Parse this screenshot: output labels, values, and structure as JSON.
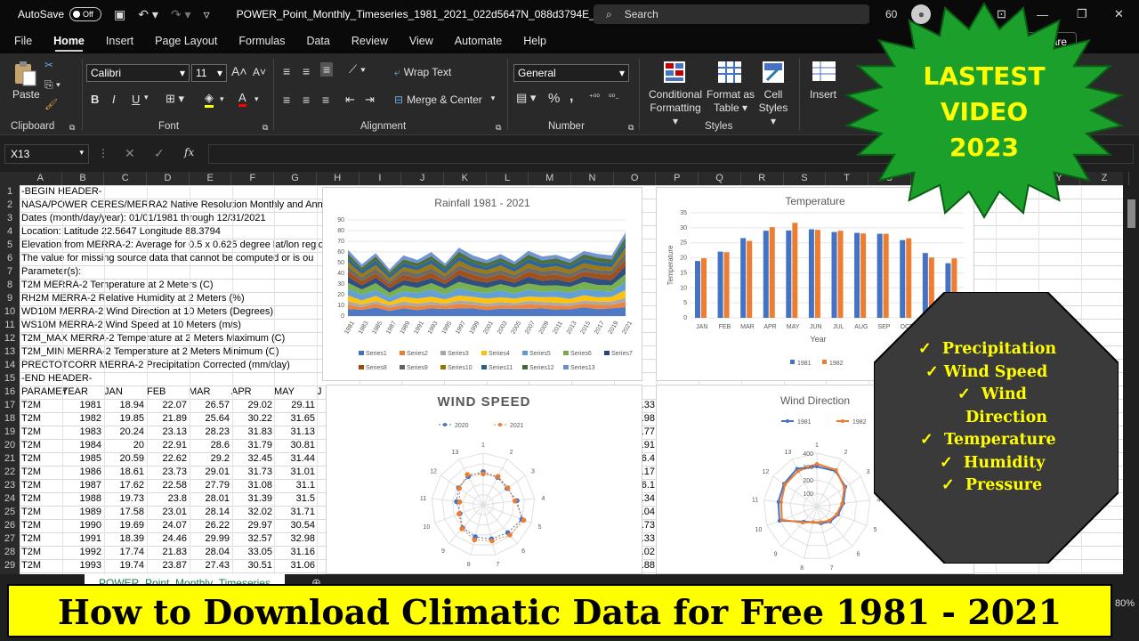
{
  "titlebar": {
    "autosave": "AutoSave",
    "toggle": "Off",
    "filename": "POWER_Point_Monthly_Timeseries_1981_2021_022d5647N_088d3794E_LST",
    "search": "Search",
    "zoom_partial": "60"
  },
  "menu": [
    "File",
    "Home",
    "Insert",
    "Page Layout",
    "Formulas",
    "Data",
    "Review",
    "View",
    "Automate",
    "Help"
  ],
  "share": "Share",
  "ribbon": {
    "clipboard": {
      "paste": "Paste",
      "label": "Clipboard"
    },
    "font": {
      "name": "Calibri",
      "size": "11",
      "label": "Font",
      "bold": "B",
      "italic": "I",
      "underline": "U"
    },
    "alignment": {
      "wrap": "Wrap Text",
      "merge": "Merge & Center",
      "label": "Alignment"
    },
    "number": {
      "format": "General",
      "label": "Number",
      "percent": "%",
      "comma": ","
    },
    "styles": {
      "conditional": "Conditional",
      "formatting": "Formatting",
      "format_as": "Format as",
      "table": "Table",
      "cell": "Cell",
      "cell_styles": "Styles",
      "label": "Styles"
    },
    "cells": {
      "insert": "Insert"
    }
  },
  "formula_bar": {
    "namebox": "X13",
    "fx": "fx"
  },
  "columns": [
    "A",
    "B",
    "C",
    "D",
    "E",
    "F",
    "G",
    "H",
    "I",
    "J",
    "K",
    "L",
    "M",
    "N",
    "O",
    "P",
    "Q",
    "R",
    "S",
    "T",
    "U",
    "V",
    "W",
    "X",
    "Y",
    "Z"
  ],
  "rows": [
    "1",
    "2",
    "3",
    "4",
    "5",
    "6",
    "7",
    "8",
    "9",
    "10",
    "11",
    "12",
    "13",
    "14",
    "15",
    "16",
    "17",
    "18",
    "19",
    "20",
    "21",
    "22",
    "23",
    "24",
    "25",
    "26",
    "27",
    "28",
    "29"
  ],
  "header_lines": [
    "-BEGIN HEADER-",
    "NASA/POWER CERES/MERRA2 Native Resolution Monthly and Annua",
    "Dates (month/day/year): 01/01/1981 through 12/31/2021",
    "Location: Latitude  22.5647   Longitude 88.3794",
    "Elevation from MERRA-2: Average for 0.5 x 0.625 degree lat/lon regio",
    "The value for missing source data that cannot be computed or is ou",
    "Parameter(s):",
    "T2M          MERRA-2 Temperature at 2 Meters (C)",
    "RH2M         MERRA-2 Relative Humidity at 2 Meters (%)",
    "WD10M        MERRA-2 Wind Direction at 10 Meters (Degrees)",
    "WS10M        MERRA-2 Wind Speed at 10 Meters (m/s)",
    "T2M_MAX      MERRA-2 Temperature at 2 Meters Maximum (C)",
    "T2M_MIN      MERRA-2 Temperature at 2 Meters Minimum (C)",
    "PRECTOTCORR    MERRA-2 Precipitation Corrected (mm/day)",
    "-END HEADER-"
  ],
  "table_header": [
    "PARAMET",
    "YEAR",
    "JAN",
    "FEB",
    "MAR",
    "APR",
    "MAY",
    "J"
  ],
  "table_rows": [
    [
      "T2M",
      "1981",
      "18.94",
      "22.07",
      "26.57",
      "29.02",
      "29.11"
    ],
    [
      "T2M",
      "1982",
      "19.85",
      "21.89",
      "25.64",
      "30.22",
      "31.65"
    ],
    [
      "T2M",
      "1983",
      "20.24",
      "23.13",
      "28.23",
      "31.83",
      "31.13"
    ],
    [
      "T2M",
      "1984",
      "20",
      "22.91",
      "28.6",
      "31.79",
      "30.81"
    ],
    [
      "T2M",
      "1985",
      "20.59",
      "22.62",
      "29.2",
      "32.45",
      "31.44"
    ],
    [
      "T2M",
      "1986",
      "18.61",
      "23.73",
      "29.01",
      "31.73",
      "31.01"
    ],
    [
      "T2M",
      "1987",
      "17.62",
      "22.58",
      "27.79",
      "31.08",
      "31.1"
    ],
    [
      "T2M",
      "1988",
      "19.73",
      "23.8",
      "28.01",
      "31.39",
      "31.5"
    ],
    [
      "T2M",
      "1989",
      "17.58",
      "23.01",
      "28.14",
      "32.02",
      "31.71"
    ],
    [
      "T2M",
      "1990",
      "19.69",
      "24.07",
      "26.22",
      "29.97",
      "30.54"
    ],
    [
      "T2M",
      "1991",
      "18.39",
      "24.46",
      "29.99",
      "32.57",
      "32.98"
    ],
    [
      "T2M",
      "1992",
      "17.74",
      "21.83",
      "28.04",
      "33.05",
      "31.16"
    ],
    [
      "T2M",
      "1993",
      "19.74",
      "23.87",
      "27.43",
      "30.51",
      "31.06"
    ]
  ],
  "col_o_values": [
    ".33",
    ".98",
    ".77",
    ".91",
    "6.4",
    ".17",
    "6.1",
    ".34",
    ".04",
    ".73",
    ".33",
    ".02",
    ".88"
  ],
  "sheet_tab": "POWER_Point_Monthly_Timeseries",
  "banner": "How to Download Climatic Data for Free 1981 - 2021",
  "zoom": "80%",
  "star_text": [
    "LASTEST",
    "VIDEO",
    "2023"
  ],
  "features": [
    "Precipitation",
    "Wind Speed",
    "Wind",
    "Direction",
    "Temperature",
    "Humidity",
    "Pressure"
  ],
  "check": "✓",
  "colors": {
    "orange": "#ed7d31",
    "blue": "#4472c4",
    "green_star": "#1ba12b",
    "yellow": "#ffff00"
  },
  "chart_data": [
    {
      "type": "area",
      "title": "Rainfall 1981 - 2021",
      "x": [
        "1981",
        "1983",
        "1985",
        "1987",
        "1989",
        "1991",
        "1993",
        "1995",
        "1997",
        "1999",
        "2001",
        "2003",
        "2005",
        "2007",
        "2009",
        "2011",
        "2013",
        "2015",
        "2017",
        "2019",
        "2021"
      ],
      "yticks": [
        "0",
        "10",
        "20",
        "30",
        "40",
        "50",
        "60",
        "70",
        "80",
        "90"
      ],
      "ylim": [
        0,
        90
      ],
      "legend": [
        "Series1",
        "Series2",
        "Series3",
        "Series4",
        "Series5",
        "Series6",
        "Series7",
        "Series8",
        "Series9",
        "Series10",
        "Series11",
        "Series12",
        "Series13"
      ],
      "stack_totals": [
        65,
        50,
        60,
        45,
        58,
        55,
        62,
        50,
        66,
        58,
        55,
        60,
        52,
        63,
        57,
        60,
        55,
        62,
        60,
        58,
        82
      ]
    },
    {
      "type": "bar",
      "title": "Temperature",
      "xlabel": "Year",
      "ylabel": "Temperature",
      "ylim": [
        0,
        35
      ],
      "yticks": [
        "0",
        "5",
        "10",
        "15",
        "20",
        "25",
        "30",
        "35"
      ],
      "categories": [
        "JAN",
        "FEB",
        "MAR",
        "APR",
        "MAY",
        "JUN",
        "JUL",
        "AUG",
        "SEP",
        "OCT",
        "NOV",
        "DEC"
      ],
      "series": [
        {
          "name": "1981",
          "values": [
            18.94,
            22.07,
            26.57,
            29.02,
            29.11,
            29.5,
            28.6,
            28.3,
            28,
            25.9,
            21.6,
            18.2
          ]
        },
        {
          "name": "1982",
          "values": [
            19.85,
            21.89,
            25.64,
            30.22,
            31.65,
            29.3,
            29,
            28.1,
            28,
            26.5,
            20.1,
            19.8
          ]
        }
      ]
    },
    {
      "type": "radar",
      "title": "WIND SPEED",
      "categories": [
        "1",
        "2",
        "3",
        "4",
        "5",
        "6",
        "7",
        "8",
        "9",
        "10",
        "11",
        "12",
        "13"
      ],
      "series": [
        {
          "name": "2020",
          "values": [
            3.2,
            3.0,
            2.8,
            3.3,
            4.0,
            3.6,
            3.4,
            3.2,
            3.0,
            2.4,
            2.6,
            2.9,
            3.1
          ]
        },
        {
          "name": "2021",
          "values": [
            3.0,
            3.1,
            2.9,
            3.1,
            4.2,
            3.9,
            3.6,
            3.5,
            3.1,
            2.5,
            2.3,
            2.8,
            3.3
          ]
        }
      ]
    },
    {
      "type": "radar",
      "title": "Wind Direction",
      "yticks": [
        "100",
        "200",
        "300",
        "400"
      ],
      "categories": [
        "1",
        "2",
        "3",
        "4",
        "5",
        "6",
        "7",
        "8",
        "9",
        "10",
        "11",
        "12",
        "13"
      ],
      "series": [
        {
          "name": "1981",
          "values": [
            300,
            300,
            260,
            200,
            170,
            150,
            130,
            120,
            150,
            300,
            290,
            300,
            320
          ]
        },
        {
          "name": "1982",
          "values": [
            320,
            310,
            250,
            190,
            160,
            140,
            120,
            120,
            160,
            280,
            270,
            290,
            300
          ]
        }
      ]
    }
  ]
}
